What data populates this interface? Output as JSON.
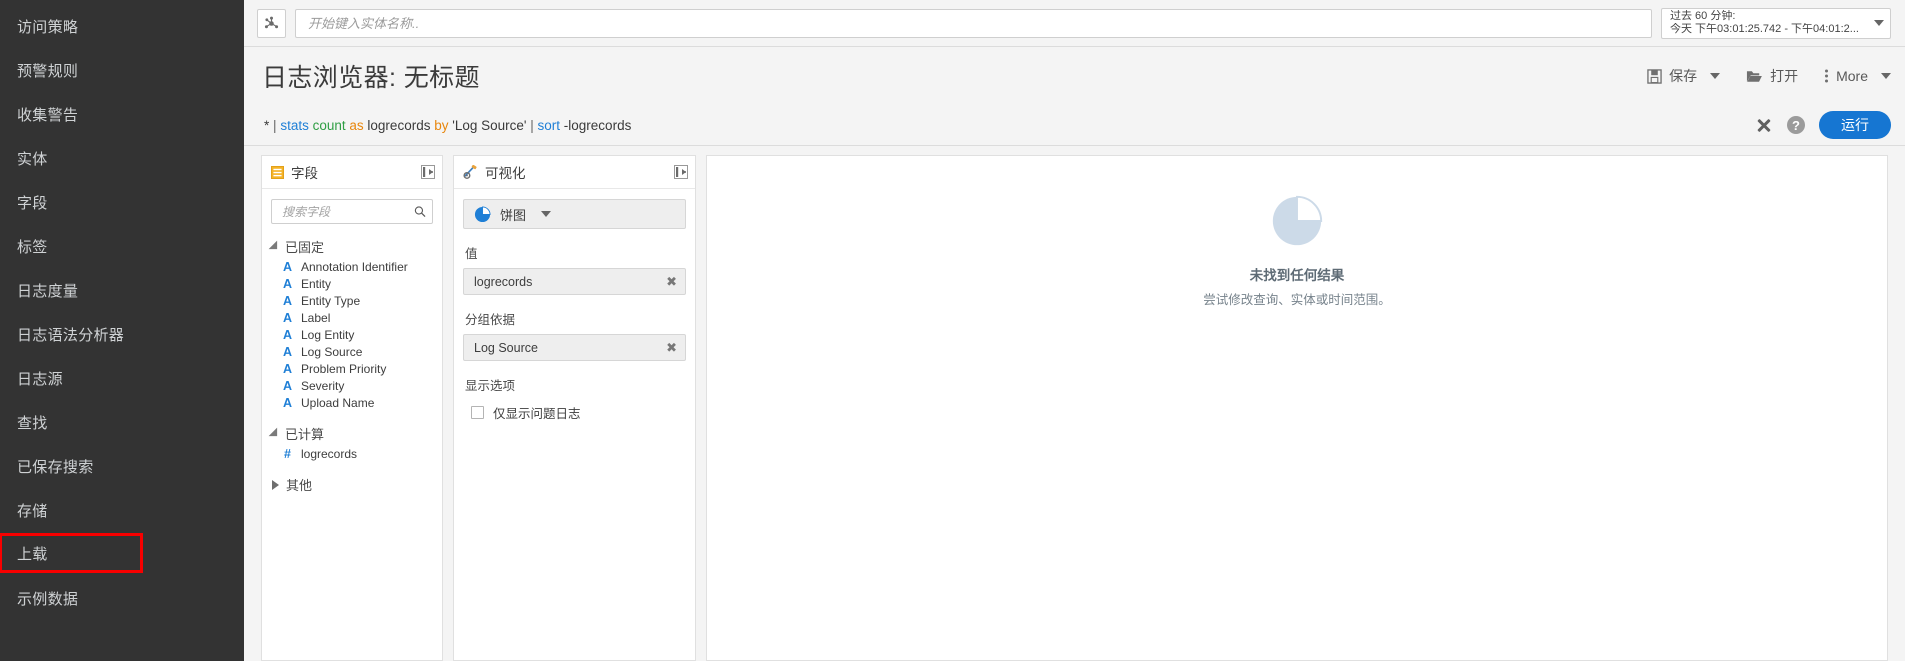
{
  "sidebar": {
    "items": [
      {
        "label": "访问策略",
        "highlighted": false
      },
      {
        "label": "预警规则",
        "highlighted": false
      },
      {
        "label": "收集警告",
        "highlighted": false
      },
      {
        "label": "实体",
        "highlighted": false
      },
      {
        "label": "字段",
        "highlighted": false
      },
      {
        "label": "标签",
        "highlighted": false
      },
      {
        "label": "日志度量",
        "highlighted": false
      },
      {
        "label": "日志语法分析器",
        "highlighted": false
      },
      {
        "label": "日志源",
        "highlighted": false
      },
      {
        "label": "查找",
        "highlighted": false
      },
      {
        "label": "已保存搜索",
        "highlighted": false
      },
      {
        "label": "存储",
        "highlighted": false
      },
      {
        "label": "上载",
        "highlighted": true
      },
      {
        "label": "示例数据",
        "highlighted": false
      }
    ],
    "highlight_color": "#f80000"
  },
  "topbar": {
    "entity_icon": "entity-graph-icon",
    "search_placeholder": "开始键入实体名称..",
    "search_value": "",
    "timerange": {
      "line1": "过去 60 分钟:",
      "line2": "今天 下午03:01:25.742 - 下午04:01:2..."
    }
  },
  "header": {
    "title": "日志浏览器: 无标题",
    "actions": [
      {
        "label": "保存",
        "icon": "save-icon",
        "has_caret": true
      },
      {
        "label": "打开",
        "icon": "folder-open-icon",
        "has_caret": false
      },
      {
        "label": "More",
        "icon": "kebab-menu-icon",
        "has_caret": true
      }
    ]
  },
  "query": {
    "tokens": [
      {
        "text": "*",
        "color": "dark"
      },
      {
        "text": "|",
        "color": "pipe"
      },
      {
        "text": "stats",
        "color": "blue"
      },
      {
        "text": "count",
        "color": "green"
      },
      {
        "text": "as",
        "color": "orange"
      },
      {
        "text": "logrecords",
        "color": "dark"
      },
      {
        "text": "by",
        "color": "orange"
      },
      {
        "text": "'Log Source'",
        "color": "dark"
      },
      {
        "text": "|",
        "color": "pipe"
      },
      {
        "text": "sort",
        "color": "blue"
      },
      {
        "text": "-logrecords",
        "color": "dark"
      }
    ],
    "clear_icon": "close-icon",
    "help_icon": "help-icon",
    "run_label": "运行",
    "run_color": "#1676d2"
  },
  "fields_panel": {
    "title": "字段",
    "icon": "fields-list-icon",
    "collapse_icon": "collapse-left-icon",
    "search_placeholder": "搜索字段",
    "search_value": "",
    "groups": [
      {
        "name": "已固定",
        "expanded": true,
        "fields": [
          {
            "type": "A",
            "name": "Annotation Identifier"
          },
          {
            "type": "A",
            "name": "Entity"
          },
          {
            "type": "A",
            "name": "Entity Type"
          },
          {
            "type": "A",
            "name": "Label"
          },
          {
            "type": "A",
            "name": "Log Entity"
          },
          {
            "type": "A",
            "name": "Log Source"
          },
          {
            "type": "A",
            "name": "Problem Priority"
          },
          {
            "type": "A",
            "name": "Severity"
          },
          {
            "type": "A",
            "name": "Upload Name"
          }
        ]
      },
      {
        "name": "已计算",
        "expanded": true,
        "fields": [
          {
            "type": "#",
            "name": "logrecords"
          }
        ]
      },
      {
        "name": "其他",
        "expanded": false,
        "fields": []
      }
    ]
  },
  "viz_panel": {
    "title": "可视化",
    "icon": "tools-config-icon",
    "collapse_icon": "collapse-left-icon",
    "chart_type": {
      "label": "饼图",
      "icon": "pie-chart-icon"
    },
    "value_label": "值",
    "value_chip": "logrecords",
    "group_label": "分组依据",
    "group_chip": "Log Source",
    "display_label": "显示选项",
    "checkbox_label": "仅显示问题日志",
    "checkbox_checked": false
  },
  "result_panel": {
    "empty_icon": "pie-chart-empty-icon",
    "empty_title": "未找到任何结果",
    "empty_subtitle": "尝试修改查询、实体或时间范围。"
  }
}
